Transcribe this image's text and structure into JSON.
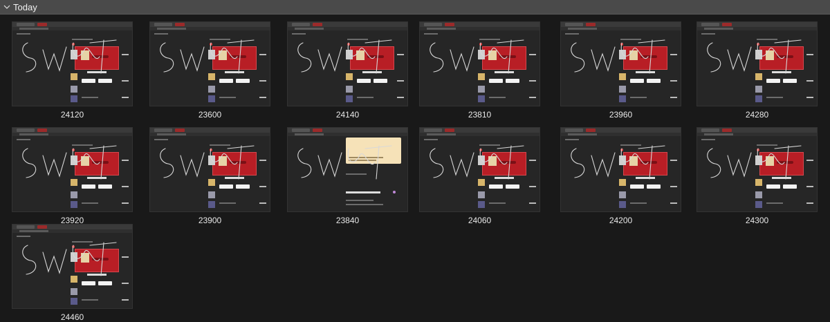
{
  "group": {
    "title": "Today"
  },
  "colors": {
    "header_bg": "#4a4a4a",
    "page_bg": "#191919",
    "card_red": "#b81e25"
  },
  "icons": {
    "collapse": "chevron-down-icon"
  },
  "tiles": [
    {
      "label": "24120"
    },
    {
      "label": "23600"
    },
    {
      "label": "24140"
    },
    {
      "label": "23810"
    },
    {
      "label": "23960"
    },
    {
      "label": "24280"
    },
    {
      "label": "23920"
    },
    {
      "label": "23900"
    },
    {
      "label": "23840"
    },
    {
      "label": "24060"
    },
    {
      "label": "24200"
    },
    {
      "label": "24300"
    },
    {
      "label": "24460"
    }
  ]
}
